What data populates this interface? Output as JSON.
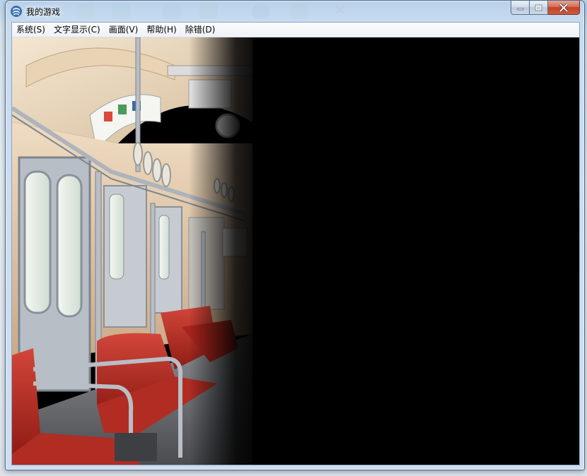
{
  "window": {
    "title": "我的游戏",
    "controls": {
      "minimize_icon": "minimize-icon",
      "maximize_icon": "maximize-icon",
      "close_icon": "close-icon"
    }
  },
  "menubar": {
    "items": [
      {
        "label": "系统(S)"
      },
      {
        "label": "文字显示(C)"
      },
      {
        "label": "画面(V)"
      },
      {
        "label": "帮助(H)"
      },
      {
        "label": "除错(D)"
      }
    ]
  },
  "game": {
    "scene": "train-interior",
    "background_color": "#000000"
  },
  "colors": {
    "seat_red": "#b8261d",
    "wall_beige": "#e3c7a6",
    "rail_gray": "#b7bcc4",
    "close_button_red": "#c24428"
  }
}
